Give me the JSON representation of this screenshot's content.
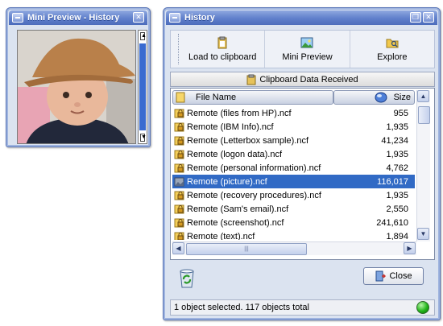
{
  "mini_preview": {
    "title": "Mini Preview - History",
    "close_glyph": "✕"
  },
  "history": {
    "title": "History",
    "toolbar": {
      "load_label": "Load to clipboard",
      "preview_label": "Mini Preview",
      "explore_label": "Explore"
    },
    "clipboard_header": "Clipboard Data Received",
    "columns": {
      "name": "File Name",
      "size": "Size"
    },
    "rows": [
      {
        "name": "Remote (files from HP).ncf",
        "size": "955"
      },
      {
        "name": "Remote (IBM Info).ncf",
        "size": "1,935"
      },
      {
        "name": "Remote (Letterbox sample).ncf",
        "size": "41,234"
      },
      {
        "name": "Remote (logon data).ncf",
        "size": "1,935"
      },
      {
        "name": "Remote (personal information).ncf",
        "size": "4,762"
      },
      {
        "name": "Remote (picture).ncf",
        "size": "116,017"
      },
      {
        "name": "Remote (recovery procedures).ncf",
        "size": "1,935"
      },
      {
        "name": "Remote (Sam's email).ncf",
        "size": "2,550"
      },
      {
        "name": "Remote (screenshot).ncf",
        "size": "241,610"
      },
      {
        "name": "Remote (text).ncf",
        "size": "1,894"
      }
    ],
    "selected_row": 5,
    "close_label": "Close",
    "status_text": "1 object selected.  117 objects total",
    "colors": {
      "selection": "#316ac5",
      "title_bar": "#5f7fcb",
      "status_led": "#22b51a"
    }
  }
}
